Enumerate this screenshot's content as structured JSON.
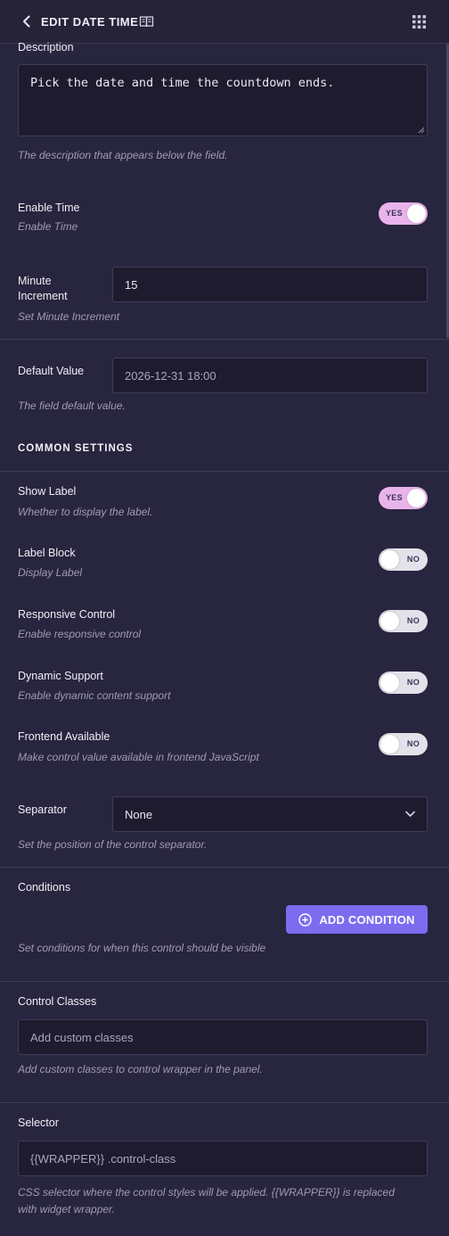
{
  "header": {
    "title": "EDIT DATE TIME",
    "back_icon": "chevron-left-icon",
    "doc_icon": "book-open-icon",
    "menu_icon": "grid-dots-icon"
  },
  "fields": {
    "description": {
      "label": "Description",
      "value": "Pick the date and time the countdown ends.",
      "help": "The description that appears below the field."
    },
    "enable_time": {
      "label": "Enable Time",
      "help": "Enable Time",
      "toggle": "YES"
    },
    "minute_increment": {
      "label_line1": "Minute",
      "label_line2": "Increment",
      "value": "15",
      "help": "Set Minute Increment"
    },
    "default_value": {
      "label": "Default Value",
      "value": "2026-12-31 18:00",
      "help": "The field default value."
    }
  },
  "common_settings": {
    "title": "COMMON SETTINGS",
    "show_label": {
      "label": "Show Label",
      "help": "Whether to display the label.",
      "toggle": "YES"
    },
    "label_block": {
      "label": "Label Block",
      "help": "Display Label",
      "toggle": "NO"
    },
    "responsive_control": {
      "label": "Responsive Control",
      "help": "Enable responsive control",
      "toggle": "NO"
    },
    "dynamic_support": {
      "label": "Dynamic Support",
      "help": "Enable dynamic content support",
      "toggle": "NO"
    },
    "frontend_available": {
      "label": "Frontend Available",
      "help": "Make control value available in frontend JavaScript",
      "toggle": "NO"
    },
    "separator": {
      "label": "Separator",
      "value": "None",
      "help": "Set the position of the control separator."
    },
    "conditions": {
      "label": "Conditions",
      "button": "ADD CONDITION",
      "help": "Set conditions for when this control should be visible"
    },
    "control_classes": {
      "label": "Control Classes",
      "placeholder": "Add custom classes",
      "help": "Add custom classes to control wrapper in the panel."
    },
    "selector": {
      "label": "Selector",
      "value": "{{WRAPPER}} .control-class",
      "help_line1": "CSS selector where the control styles will be applied. {{WRAPPER}} is replaced",
      "help_line2": "with widget wrapper."
    }
  },
  "colors": {
    "background": "#28253f",
    "accent": "#7b6cf0",
    "toggle_on": "#e9b4ec",
    "toggle_off": "#e3e2ea"
  }
}
